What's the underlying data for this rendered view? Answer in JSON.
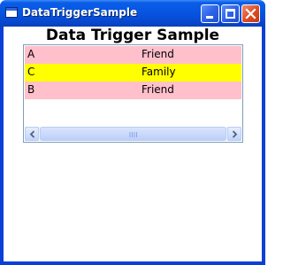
{
  "window": {
    "title": "DataTriggerSample",
    "controls": {
      "minimize": "minimize",
      "maximize": "maximize",
      "close": "close"
    }
  },
  "main": {
    "heading": "Data Trigger Sample",
    "list": {
      "rows": [
        {
          "name": "A",
          "role": "Friend",
          "background": "#ffc0cb"
        },
        {
          "name": "C",
          "role": "Family",
          "background": "#ffff00"
        },
        {
          "name": "B",
          "role": "Friend",
          "background": "#ffc0cb"
        }
      ]
    },
    "scrollbar": {
      "left_icon": "chevron-left-icon",
      "right_icon": "chevron-right-icon",
      "thumb_grip_icon": "grip-icon"
    }
  },
  "colors": {
    "titlebar": "#0654e0",
    "friend_row": "#ffc0cb",
    "family_row": "#ffff00",
    "close_button": "#dc4c23"
  }
}
